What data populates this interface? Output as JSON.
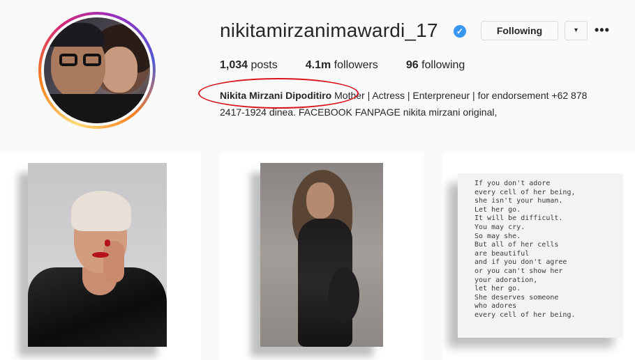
{
  "profile": {
    "username": "nikitamirzanimawardi_17",
    "verified_icon": "verified-badge-icon",
    "follow_button": "Following",
    "dropdown_icon": "▾",
    "more_icon": "•••"
  },
  "stats": {
    "posts_count": "1,034",
    "posts_label": "posts",
    "followers_count": "4.1m",
    "followers_label": "followers",
    "following_count": "96",
    "following_label": "following"
  },
  "bio": {
    "name": "Nikita Mirzani Dipoditiro",
    "line1_rest": " Mother | Actress | Enterpreneur | for endorsement +62 878",
    "line2": "2417-1924 dinea. FACEBOOK FANPAGE nikita mirzani original,"
  },
  "posts": {
    "poem": "If you don't adore\nevery cell of her being,\nshe isn't your human.\nLet her go.\nIt will be difficult.\nYou may cry.\nSo may she.\nBut all of her cells\nare beautiful\nand if you don't agree\nor you can't show her\nyour adoration,\nlet her go.\nShe deserves someone\nwho adores\nevery cell of her being."
  },
  "colors": {
    "verified": "#3897f0",
    "annotation": "#d9141d",
    "lipstick": "#b3121c"
  }
}
